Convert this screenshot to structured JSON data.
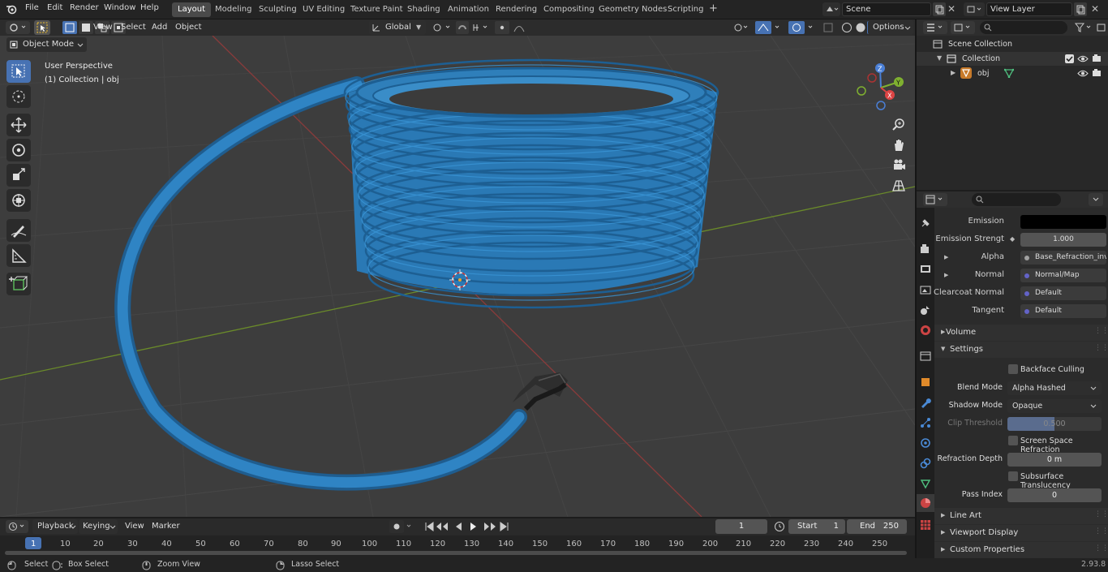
{
  "topbar": {
    "menus": [
      "File",
      "Edit",
      "Render",
      "Window",
      "Help"
    ],
    "workspaces": [
      "Layout",
      "Modeling",
      "Sculpting",
      "UV Editing",
      "Texture Paint",
      "Shading",
      "Animation",
      "Rendering",
      "Compositing",
      "Geometry Nodes",
      "Scripting"
    ],
    "active_workspace": "Layout",
    "scene": "Scene",
    "view_layer": "View Layer"
  },
  "viewport_header": {
    "mode": "Object Mode",
    "menus": [
      "View",
      "Select",
      "Add",
      "Object"
    ],
    "orientation": "Global",
    "options": "Options"
  },
  "viewport": {
    "perspective": "User Perspective",
    "collection_label": "(1) Collection | obj",
    "gizmo": {
      "x": "X",
      "y": "Y",
      "z": "Z"
    }
  },
  "outliner": {
    "scene_collection": "Scene Collection",
    "collection": "Collection",
    "object": "obj"
  },
  "properties": {
    "rows": [
      {
        "label": "Emission",
        "value": "",
        "dot": "#c7c729",
        "kind": "color"
      },
      {
        "label": "Emission Strengt",
        "value": "1.000",
        "dot": "#a0a0a0",
        "kind": "num"
      },
      {
        "label": "Alpha",
        "value": "Base_Refraction_inv...",
        "dot": "#a0a0a0",
        "kind": "link"
      },
      {
        "label": "Normal",
        "value": "Normal/Map",
        "dot": "#6363c7",
        "kind": "link"
      },
      {
        "label": "Clearcoat Normal",
        "value": "Default",
        "dot": "#6363c7",
        "kind": "link"
      },
      {
        "label": "Tangent",
        "value": "Default",
        "dot": "#6363c7",
        "kind": "link"
      }
    ],
    "volume": "Volume",
    "settings": "Settings",
    "backface_culling": "Backface Culling",
    "blend_mode_label": "Blend Mode",
    "blend_mode": "Alpha Hashed",
    "shadow_mode_label": "Shadow Mode",
    "shadow_mode": "Opaque",
    "clip_threshold_label": "Clip Threshold",
    "clip_threshold": "0.500",
    "ssr": "Screen Space Refraction",
    "refraction_depth_label": "Refraction Depth",
    "refraction_depth": "0 m",
    "subsurface": "Subsurface Translucency",
    "pass_index_label": "Pass Index",
    "pass_index": "0",
    "line_art": "Line Art",
    "viewport_display": "Viewport Display",
    "custom_properties": "Custom Properties"
  },
  "timeline": {
    "menus": [
      "Playback",
      "Keying",
      "View",
      "Marker"
    ],
    "current_frame": "1",
    "start_label": "Start",
    "start": "1",
    "end_label": "End",
    "end": "250",
    "ticks": [
      "1",
      "10",
      "20",
      "30",
      "40",
      "50",
      "60",
      "70",
      "80",
      "90",
      "100",
      "110",
      "120",
      "130",
      "140",
      "150",
      "160",
      "170",
      "180",
      "190",
      "200",
      "210",
      "220",
      "230",
      "240",
      "250"
    ]
  },
  "statusbar": {
    "select": "Select",
    "box_select": "Box Select",
    "zoom_view": "Zoom View",
    "lasso_select": "Lasso Select",
    "version": "2.93.8"
  }
}
